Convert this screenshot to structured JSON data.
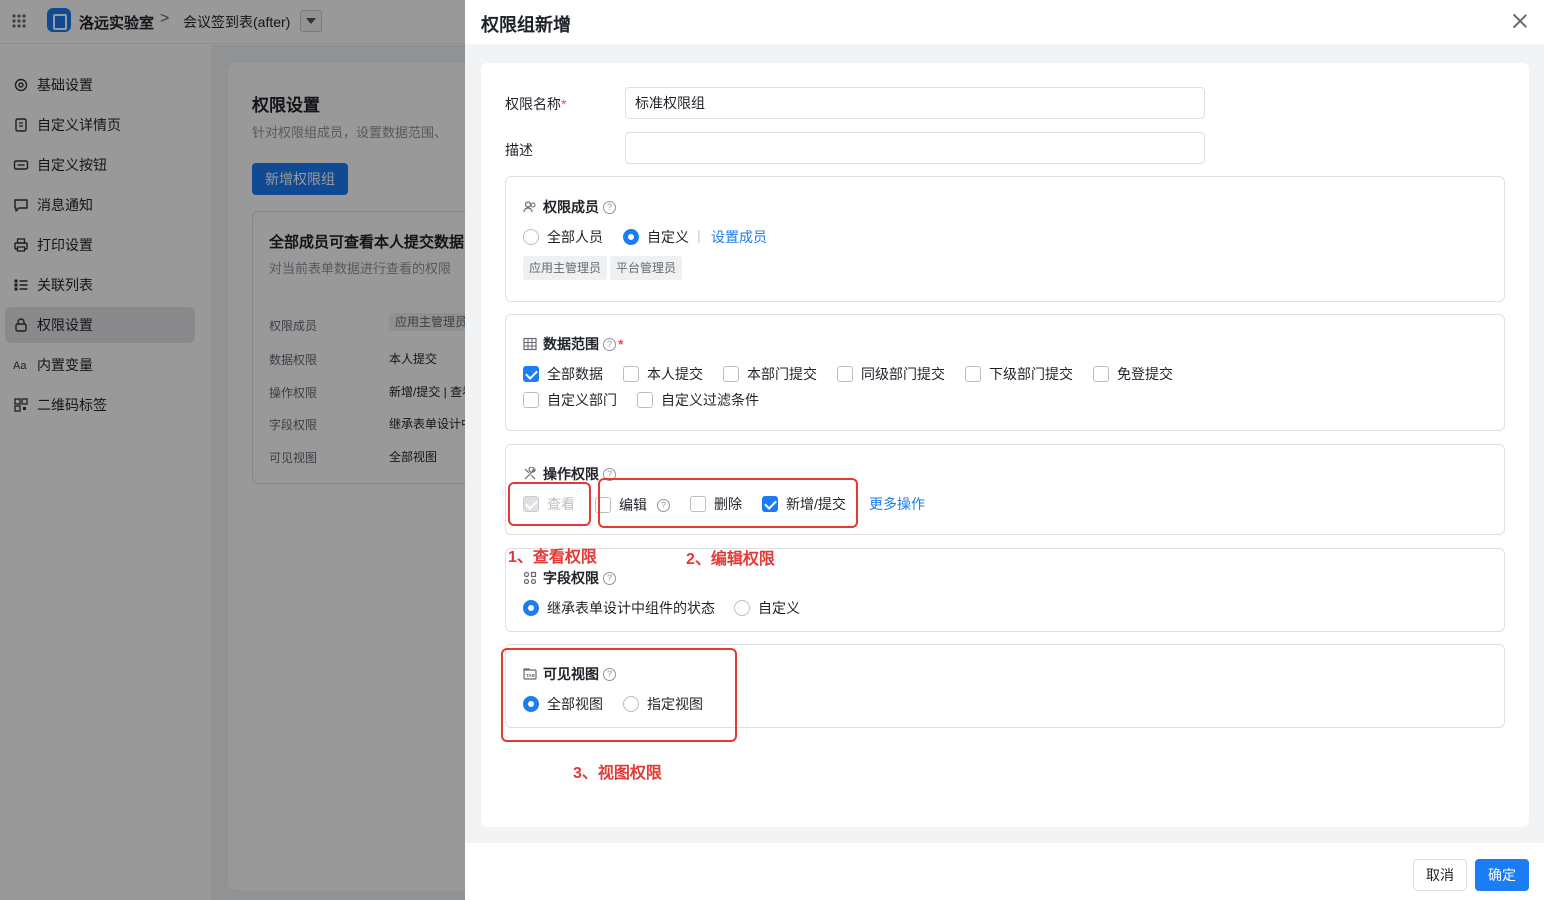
{
  "topbar": {
    "app_name": "洛远实验室",
    "separator": ">",
    "form_name": "会议签到表(after)"
  },
  "sidebar": {
    "items": [
      {
        "label": "基础设置",
        "icon": "gear-icon"
      },
      {
        "label": "自定义详情页",
        "icon": "document-icon"
      },
      {
        "label": "自定义按钮",
        "icon": "button-icon"
      },
      {
        "label": "消息通知",
        "icon": "message-icon"
      },
      {
        "label": "打印设置",
        "icon": "printer-icon"
      },
      {
        "label": "关联列表",
        "icon": "list-icon"
      },
      {
        "label": "权限设置",
        "icon": "lock-icon",
        "active": true
      },
      {
        "label": "内置变量",
        "icon": "text-aa-icon"
      },
      {
        "label": "二维码标签",
        "icon": "qrcode-icon"
      }
    ]
  },
  "main": {
    "title": "权限设置",
    "desc": "针对权限组成员，设置数据范围、",
    "add_button": "新增权限组",
    "group_card": {
      "title": "全部成员可查看本人提交数据",
      "desc": "对当前表单数据进行查看的权限",
      "rows": [
        {
          "label": "权限成员",
          "value": "应用主管理员"
        },
        {
          "label": "数据权限",
          "value": "本人提交"
        },
        {
          "label": "操作权限",
          "value": "新增/提交 | 查看"
        },
        {
          "label": "字段权限",
          "value": "继承表单设计中"
        },
        {
          "label": "可见视图",
          "value": "全部视图"
        }
      ]
    }
  },
  "drawer": {
    "title": "权限组新增",
    "name_label": "权限名称",
    "name_required": "*",
    "name_value": "标准权限组",
    "desc_label": "描述",
    "desc_value": "",
    "members": {
      "title": "权限成员",
      "help": "?",
      "options": [
        "全部人员",
        "自定义"
      ],
      "selected": "自定义",
      "divider": "|",
      "set_link": "设置成员",
      "tags": [
        "应用主管理员",
        "平台管理员"
      ]
    },
    "scope": {
      "title": "数据范围",
      "help": "?",
      "required": "*",
      "options": [
        {
          "label": "全部数据",
          "checked": true
        },
        {
          "label": "本人提交",
          "checked": false
        },
        {
          "label": "本部门提交",
          "checked": false
        },
        {
          "label": "同级部门提交",
          "checked": false
        },
        {
          "label": "下级部门提交",
          "checked": false
        },
        {
          "label": "免登提交",
          "checked": false
        },
        {
          "label": "自定义部门",
          "checked": false
        },
        {
          "label": "自定义过滤条件",
          "checked": false
        }
      ]
    },
    "ops": {
      "title": "操作权限",
      "help": "?",
      "view": "查看",
      "edit": "编辑",
      "delete": "删除",
      "add": "新增/提交",
      "more": "更多操作"
    },
    "fields": {
      "title": "字段权限",
      "help": "?",
      "options": [
        "继承表单设计中组件的状态",
        "自定义"
      ],
      "selected": "继承表单设计中组件的状态"
    },
    "views": {
      "title": "可见视图",
      "help": "?",
      "options": [
        "全部视图",
        "指定视图"
      ],
      "selected": "全部视图"
    },
    "cancel": "取消",
    "ok": "确定"
  },
  "annotations": {
    "a1": "1、查看权限",
    "a2": "2、编辑权限",
    "a3": "3、视图权限",
    "color": "#e53935"
  },
  "colors": {
    "accent": "#1b7cf3",
    "required": "#f54a45"
  }
}
